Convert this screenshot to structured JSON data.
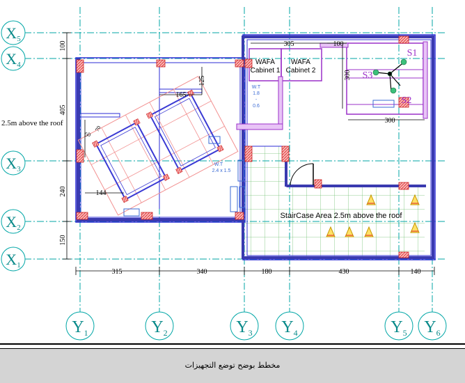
{
  "grid_x": [
    {
      "label": "X",
      "sub": "5"
    },
    {
      "label": "X",
      "sub": "4"
    },
    {
      "label": "X",
      "sub": "3"
    },
    {
      "label": "X",
      "sub": "2"
    },
    {
      "label": "X",
      "sub": "1"
    }
  ],
  "grid_y": [
    {
      "label": "Y",
      "sub": "1"
    },
    {
      "label": "Y",
      "sub": "2"
    },
    {
      "label": "Y",
      "sub": "3"
    },
    {
      "label": "Y",
      "sub": "4"
    },
    {
      "label": "Y",
      "sub": "5"
    },
    {
      "label": "Y",
      "sub": "6"
    }
  ],
  "dims_bottom": [
    "315",
    "340",
    "180",
    "430",
    "140"
  ],
  "dims_left": [
    "100",
    "405",
    "240",
    "150"
  ],
  "dims_room": {
    "top_305": "305",
    "top_100": "100",
    "right_300": "300",
    "bottom_300": "300",
    "width_165": "165",
    "v_125": "125",
    "v_50": "50",
    "v_70": "70",
    "h_144": "144"
  },
  "labels": {
    "roof_note": "2.5m above the roof",
    "cabinet1_a": "WAFA",
    "cabinet1_b": "Cabinet 1",
    "cabinet2_a": "WAFA",
    "cabinet2_b": "Cabinet 2",
    "s1": "S1",
    "s2": "S2",
    "s3": "S3",
    "wt1_a": "W.T",
    "wt1_b": "1.8",
    "wt1_c": "-",
    "wt1_d": "0.6",
    "wt2_a": "W.T",
    "wt2_b": "2.4 x 1.5",
    "staircase": "StairCase Area 2.5m  above the roof"
  },
  "caption": "مخطط بوضح توضع التجهيزات",
  "colors": {
    "grid": "#00a6a6",
    "wall": "#2b2bd4",
    "column": "#d9343c",
    "purple": "#9b30c9",
    "hatch": "#e36f6f",
    "stair": "#2f9b2f"
  }
}
